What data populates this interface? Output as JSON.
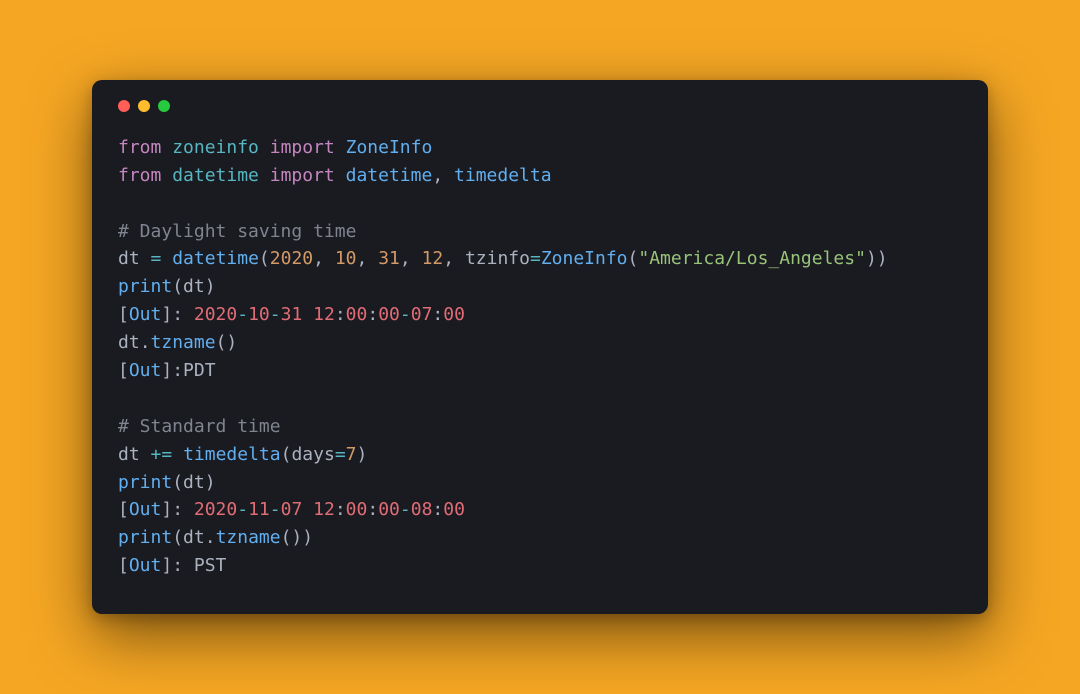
{
  "colors": {
    "bg": "#f5a623",
    "card": "#1a1a21",
    "dot_red": "#ff5f56",
    "dot_yellow": "#ffbd2e",
    "dot_green": "#27c93f"
  },
  "traffic_lights": [
    "close",
    "minimize",
    "zoom"
  ],
  "lines": [
    [
      [
        "k",
        "from"
      ],
      [
        "w",
        " "
      ],
      [
        "mod",
        "zoneinfo"
      ],
      [
        "w",
        " "
      ],
      [
        "k",
        "import"
      ],
      [
        "w",
        " "
      ],
      [
        "cls",
        "ZoneInfo"
      ]
    ],
    [
      [
        "k",
        "from"
      ],
      [
        "w",
        " "
      ],
      [
        "mod",
        "datetime"
      ],
      [
        "w",
        " "
      ],
      [
        "k",
        "import"
      ],
      [
        "w",
        " "
      ],
      [
        "cls",
        "datetime"
      ],
      [
        "p",
        ", "
      ],
      [
        "cls",
        "timedelta"
      ]
    ],
    [],
    [
      [
        "com",
        "# Daylight saving time"
      ]
    ],
    [
      [
        "id",
        "dt"
      ],
      [
        "w",
        " "
      ],
      [
        "op",
        "="
      ],
      [
        "w",
        " "
      ],
      [
        "cls",
        "datetime"
      ],
      [
        "p",
        "("
      ],
      [
        "num",
        "2020"
      ],
      [
        "p",
        ", "
      ],
      [
        "num",
        "10"
      ],
      [
        "p",
        ", "
      ],
      [
        "num",
        "31"
      ],
      [
        "p",
        ", "
      ],
      [
        "num",
        "12"
      ],
      [
        "p",
        ", "
      ],
      [
        "id",
        "tzinfo"
      ],
      [
        "op",
        "="
      ],
      [
        "cls",
        "ZoneInfo"
      ],
      [
        "p",
        "("
      ],
      [
        "str",
        "\"America/Los_Angeles\""
      ],
      [
        "p",
        "))"
      ]
    ],
    [
      [
        "cls",
        "print"
      ],
      [
        "p",
        "("
      ],
      [
        "id",
        "dt"
      ],
      [
        "p",
        ")"
      ]
    ],
    [
      [
        "p",
        "["
      ],
      [
        "out",
        "Out"
      ],
      [
        "p",
        "]: "
      ],
      [
        "numr",
        "2020"
      ],
      [
        "dash",
        "-"
      ],
      [
        "numr",
        "10"
      ],
      [
        "dash",
        "-"
      ],
      [
        "numr",
        "31"
      ],
      [
        "w",
        " "
      ],
      [
        "numr",
        "12"
      ],
      [
        "p",
        ":"
      ],
      [
        "numr",
        "00"
      ],
      [
        "p",
        ":"
      ],
      [
        "numr",
        "00"
      ],
      [
        "dash",
        "-"
      ],
      [
        "numr",
        "07"
      ],
      [
        "p",
        ":"
      ],
      [
        "numr",
        "00"
      ]
    ],
    [
      [
        "id",
        "dt"
      ],
      [
        "p",
        "."
      ],
      [
        "cls",
        "tzname"
      ],
      [
        "p",
        "()"
      ]
    ],
    [
      [
        "p",
        "["
      ],
      [
        "out",
        "Out"
      ],
      [
        "p",
        "]:"
      ],
      [
        "id",
        "PDT"
      ]
    ],
    [],
    [
      [
        "com",
        "# Standard time"
      ]
    ],
    [
      [
        "id",
        "dt"
      ],
      [
        "w",
        " "
      ],
      [
        "op",
        "+="
      ],
      [
        "w",
        " "
      ],
      [
        "cls",
        "timedelta"
      ],
      [
        "p",
        "("
      ],
      [
        "id",
        "days"
      ],
      [
        "op",
        "="
      ],
      [
        "num",
        "7"
      ],
      [
        "p",
        ")"
      ]
    ],
    [
      [
        "cls",
        "print"
      ],
      [
        "p",
        "("
      ],
      [
        "id",
        "dt"
      ],
      [
        "p",
        ")"
      ]
    ],
    [
      [
        "p",
        "["
      ],
      [
        "out",
        "Out"
      ],
      [
        "p",
        "]: "
      ],
      [
        "numr",
        "2020"
      ],
      [
        "dash",
        "-"
      ],
      [
        "numr",
        "11"
      ],
      [
        "dash",
        "-"
      ],
      [
        "numr",
        "07"
      ],
      [
        "w",
        " "
      ],
      [
        "numr",
        "12"
      ],
      [
        "p",
        ":"
      ],
      [
        "numr",
        "00"
      ],
      [
        "p",
        ":"
      ],
      [
        "numr",
        "00"
      ],
      [
        "dash",
        "-"
      ],
      [
        "numr",
        "08"
      ],
      [
        "p",
        ":"
      ],
      [
        "numr",
        "00"
      ]
    ],
    [
      [
        "cls",
        "print"
      ],
      [
        "p",
        "("
      ],
      [
        "id",
        "dt"
      ],
      [
        "p",
        "."
      ],
      [
        "cls",
        "tzname"
      ],
      [
        "p",
        "())"
      ]
    ],
    [
      [
        "p",
        "["
      ],
      [
        "out",
        "Out"
      ],
      [
        "p",
        "]: "
      ],
      [
        "id",
        "PST"
      ]
    ]
  ]
}
